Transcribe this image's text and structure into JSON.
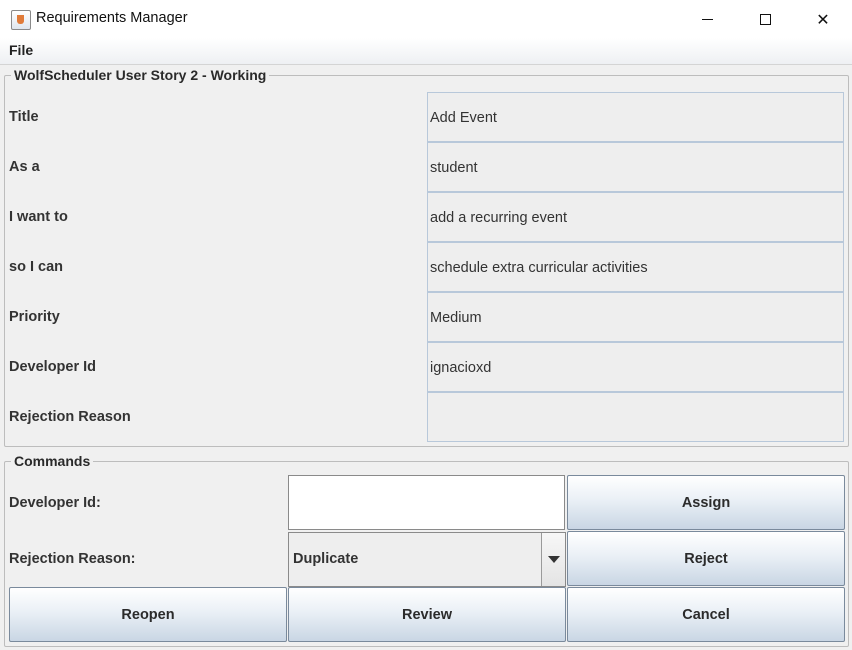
{
  "window": {
    "title": "Requirements Manager"
  },
  "menubar": {
    "file_label": "File"
  },
  "story_panel": {
    "title": "WolfScheduler User Story 2 - Working",
    "fields": [
      {
        "label": "Title",
        "value": "Add Event"
      },
      {
        "label": "As a",
        "value": "student"
      },
      {
        "label": "I want to",
        "value": "add a recurring event"
      },
      {
        "label": "so I can",
        "value": "schedule extra curricular activities"
      },
      {
        "label": "Priority",
        "value": "Medium"
      },
      {
        "label": "Developer Id",
        "value": "ignacioxd"
      },
      {
        "label": "Rejection Reason",
        "value": ""
      }
    ]
  },
  "commands_panel": {
    "title": "Commands",
    "developer_id_label": "Developer Id:",
    "developer_id_value": "",
    "rejection_reason_label": "Rejection Reason:",
    "rejection_reason_selected": "Duplicate",
    "buttons": {
      "assign": "Assign",
      "reject": "Reject",
      "reopen": "Reopen",
      "review": "Review",
      "cancel": "Cancel"
    }
  }
}
